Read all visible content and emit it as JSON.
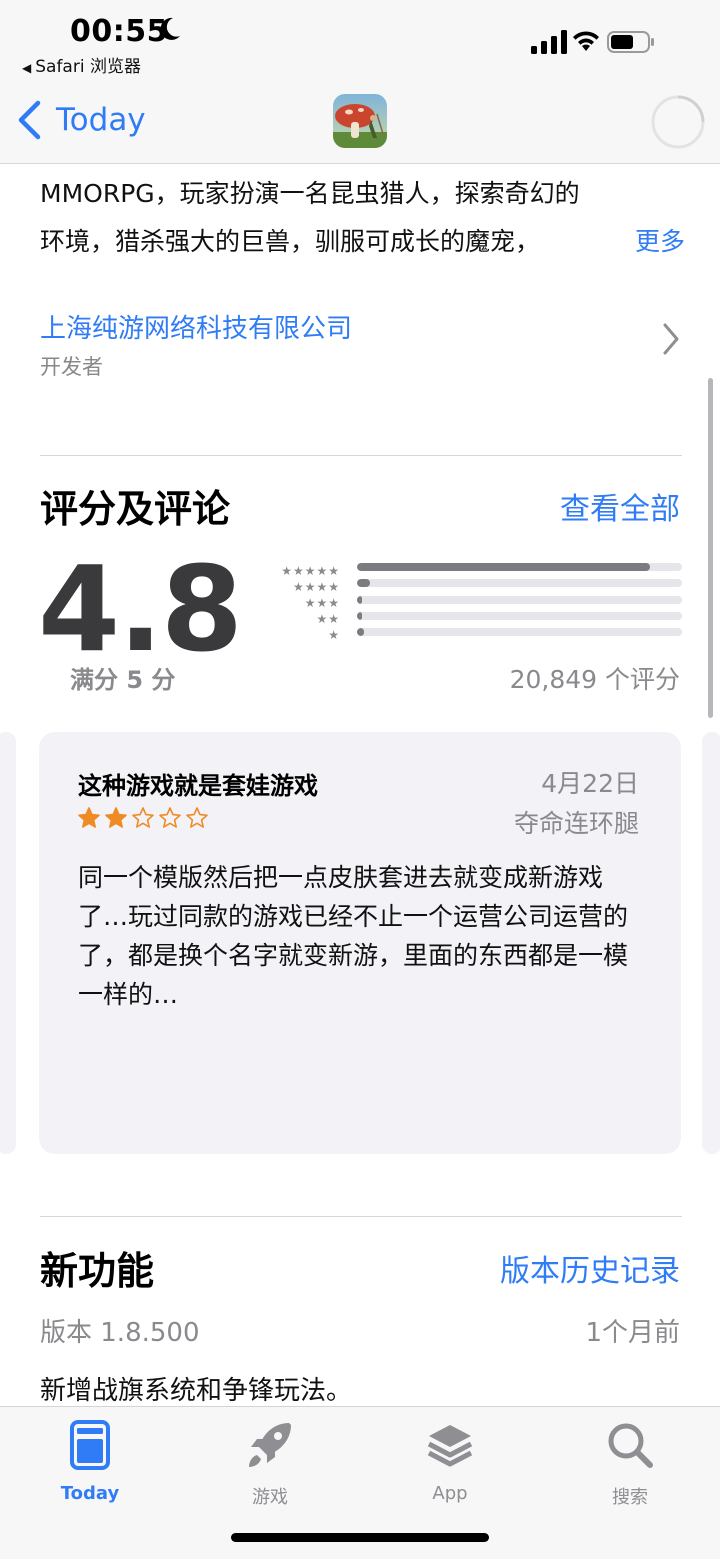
{
  "status_bar": {
    "time": "00:55",
    "back_app": "Safari 浏览器",
    "icons": [
      "moon-icon",
      "signal-icon",
      "wifi-icon",
      "battery-icon"
    ]
  },
  "nav": {
    "back_label": "Today",
    "icon": "app-icon"
  },
  "description": {
    "line1": "MMORPG，玩家扮演一名昆虫猎人，探索奇幻的",
    "line2": "环境，猎杀强大的巨兽，驯服可成长的魔宠，",
    "more": "更多"
  },
  "developer": {
    "name": "上海纯游网络科技有限公司",
    "label": "开发者"
  },
  "ratings": {
    "title": "评分及评论",
    "see_all": "查看全部",
    "average": "4.8",
    "out_of": "满分 5 分",
    "count": "20,849 个评分",
    "distribution": [
      0.9,
      0.04,
      0.005,
      0.005,
      0.02
    ],
    "star_rows": [
      "★★★★★",
      "★★★★",
      "★★★",
      "★★",
      "★"
    ]
  },
  "review": {
    "title": "这种游戏就是套娃游戏",
    "date": "4月22日",
    "author": "夺命连环腿",
    "stars": 2,
    "body": "同一个模版然后把一点皮肤套进去就变成新游戏了…玩过同款的游戏已经不止一个运营公司运营的了，都是换个名字就变新游，里面的东西都是一模一样的…"
  },
  "whats_new": {
    "title": "新功能",
    "history_link": "版本历史记录",
    "version": "版本 1.8.500",
    "age": "1个月前",
    "notes": "新增战旗系统和争锋玩法。"
  },
  "tabs": [
    {
      "label": "Today",
      "icon": "today-icon",
      "active": true
    },
    {
      "label": "游戏",
      "icon": "rocket-icon",
      "active": false
    },
    {
      "label": "App",
      "icon": "layers-icon",
      "active": false
    },
    {
      "label": "搜索",
      "icon": "search-icon",
      "active": false
    }
  ],
  "colors": {
    "accent": "#2f7cf6",
    "card_bg": "#f2f2f7",
    "star_orange": "#f08a24",
    "secondary_text": "#8a8a8e"
  }
}
